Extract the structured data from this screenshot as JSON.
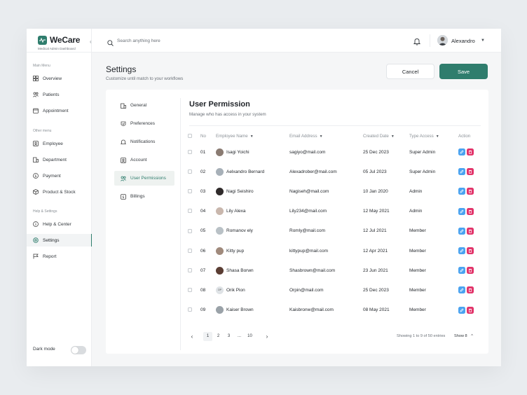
{
  "brand": {
    "name": "WeCare",
    "subtitle": "Medical Admin Dashboard"
  },
  "sidebar": {
    "sections": [
      {
        "label": "Main Menu",
        "items": [
          {
            "label": "Overview",
            "icon": "grid-icon"
          },
          {
            "label": "Patients",
            "icon": "users-icon"
          },
          {
            "label": "Appointment",
            "icon": "calendar-icon"
          }
        ]
      },
      {
        "label": "Other menu",
        "items": [
          {
            "label": "Employee",
            "icon": "id-card-icon"
          },
          {
            "label": "Department",
            "icon": "building-icon"
          },
          {
            "label": "Payment",
            "icon": "dollar-icon"
          },
          {
            "label": "Product & Stock",
            "icon": "box-icon"
          }
        ]
      },
      {
        "label": "Help & Settings",
        "items": [
          {
            "label": "Help & Center",
            "icon": "info-icon"
          },
          {
            "label": "Settings",
            "icon": "gear-icon",
            "active": true
          },
          {
            "label": "Report",
            "icon": "flag-icon"
          }
        ]
      }
    ],
    "dark_mode_label": "Dark mode"
  },
  "topbar": {
    "search_placeholder": "Search anything here",
    "user_name": "Alexandro"
  },
  "page": {
    "title": "Settings",
    "subtitle": "Customize until match to your workflows",
    "cancel_label": "Cancel",
    "save_label": "Save"
  },
  "settings_nav": [
    {
      "label": "General",
      "icon": "building-icon"
    },
    {
      "label": "Preferences",
      "icon": "sliders-icon"
    },
    {
      "label": "Notifications",
      "icon": "bell-icon"
    },
    {
      "label": "Account",
      "icon": "user-icon"
    },
    {
      "label": "User Permissions",
      "icon": "users-icon",
      "active": true
    },
    {
      "label": "Billings",
      "icon": "dollar-icon"
    }
  ],
  "panel": {
    "title": "User Permission",
    "subtitle": "Manage who has access in your system",
    "columns": {
      "no": "No",
      "employee": "Employee Name",
      "email": "Email Address",
      "created": "Created Date",
      "type": "Type Access",
      "action": "Action"
    },
    "rows": [
      {
        "no": "01",
        "name": "Isagi Yoichi",
        "email": "sagiyo@mail.com",
        "date": "25 Dec 2023",
        "type": "Super Admin",
        "avatar_color": "#8a7b72",
        "initials": ""
      },
      {
        "no": "02",
        "name": "Aelxandro Bernard",
        "email": "Alexadrober@mail.com",
        "date": "05 Jul 2023",
        "type": "Super Admin",
        "avatar_color": "#a7b0b8",
        "initials": ""
      },
      {
        "no": "03",
        "name": "Nagi Seishiro",
        "email": "Nagiseh@mail.com",
        "date": "10 Jan 2020",
        "type": "Admin",
        "avatar_color": "#2f2a2a",
        "initials": ""
      },
      {
        "no": "04",
        "name": "Lily Alexa",
        "email": "Lily234@mail.com",
        "date": "12 May 2021",
        "type": "Admin",
        "avatar_color": "#c9b7ad",
        "initials": ""
      },
      {
        "no": "05",
        "name": "Romanov ely",
        "email": "Romly@mail.com",
        "date": "12 Jul 2021",
        "type": "Member",
        "avatar_color": "#b9c1c6",
        "initials": ""
      },
      {
        "no": "06",
        "name": "Kitty pup",
        "email": "kittypup@mail.com",
        "date": "12 Apr 2021",
        "type": "Member",
        "avatar_color": "#a08a7c",
        "initials": ""
      },
      {
        "no": "07",
        "name": "Shasa Borwn",
        "email": "Shasbrown@mail.com",
        "date": "23 Jun 2021",
        "type": "Member",
        "avatar_color": "#5a3d33",
        "initials": ""
      },
      {
        "no": "08",
        "name": "Orik Pion",
        "email": "Orpin@mail.com",
        "date": "25 Dec 2023",
        "type": "Member",
        "avatar_color": "#dfe3e6",
        "initials": "OP"
      },
      {
        "no": "09",
        "name": "Kaiser Brown",
        "email": "Kaisbronw@mail.com",
        "date": "08 May 2021",
        "type": "Member",
        "avatar_color": "#9aa2a8",
        "initials": ""
      }
    ]
  },
  "pagination": {
    "pages": [
      "1",
      "2",
      "3",
      "...",
      "10"
    ],
    "active_page": "1",
    "showing": "Showing 1 to 9 of 50 entries",
    "show_per_page": "Show 8"
  },
  "colors": {
    "accent": "#2f7d6d",
    "edit": "#4aa3f0",
    "delete": "#e2346a"
  }
}
